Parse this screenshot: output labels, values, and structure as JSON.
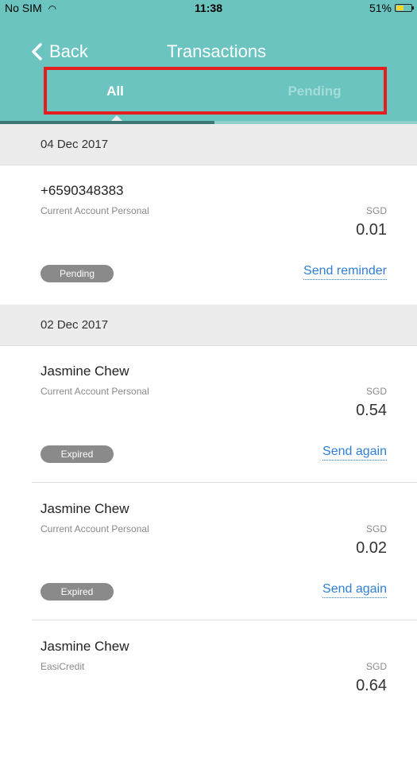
{
  "status_bar": {
    "carrier": "No SIM",
    "time": "11:38",
    "battery": "51%",
    "battery_level": 0.51
  },
  "nav": {
    "back_label": "Back",
    "title": "Transactions"
  },
  "tabs": {
    "all_label": "All",
    "pending_label": "Pending",
    "selected": "All"
  },
  "sections": [
    {
      "date": "04 Dec 2017",
      "transactions": [
        {
          "name": "+6590348383",
          "account": "Current Account Personal",
          "currency": "SGD",
          "amount": "0.01",
          "status": "Pending",
          "action": "Send reminder"
        }
      ]
    },
    {
      "date": "02 Dec 2017",
      "transactions": [
        {
          "name": "Jasmine Chew",
          "account": "Current Account Personal",
          "currency": "SGD",
          "amount": "0.54",
          "status": "Expired",
          "action": "Send again"
        },
        {
          "name": "Jasmine Chew",
          "account": "Current Account Personal",
          "currency": "SGD",
          "amount": "0.02",
          "status": "Expired",
          "action": "Send again"
        },
        {
          "name": "Jasmine Chew",
          "account": "EasiCredit",
          "currency": "SGD",
          "amount": "0.64"
        }
      ]
    }
  ],
  "colors": {
    "header": "#6bc4bf",
    "highlight_border": "#e41e1e",
    "link": "#2f7fd6",
    "badge": "#8a8a8a"
  }
}
